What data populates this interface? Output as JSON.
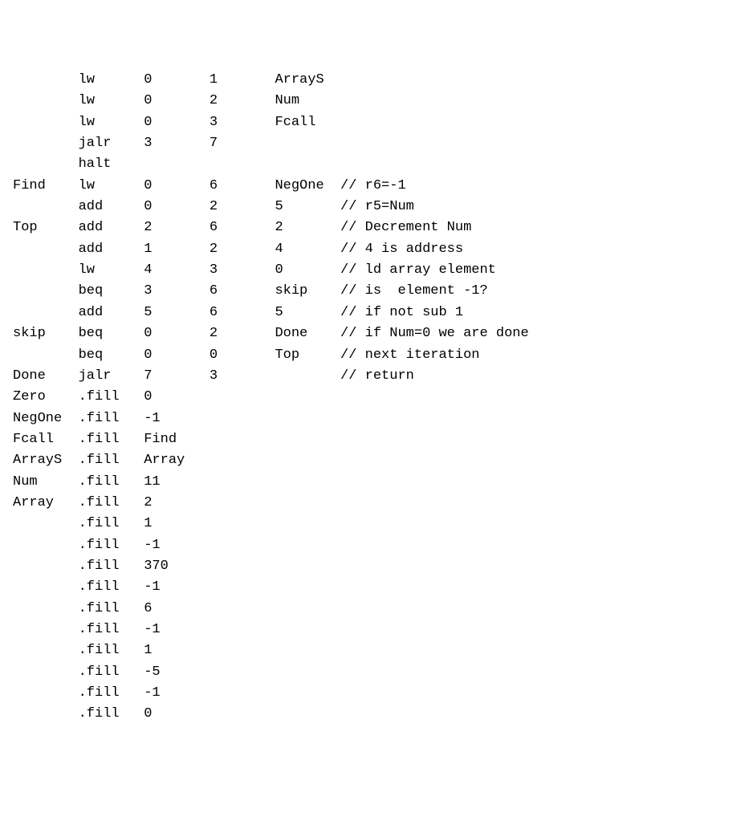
{
  "rows": [
    {
      "label": "",
      "op": "lw",
      "a": "0",
      "b": "1",
      "c": "ArrayS",
      "cm": ""
    },
    {
      "label": "",
      "op": "lw",
      "a": "0",
      "b": "2",
      "c": "Num",
      "cm": ""
    },
    {
      "label": "",
      "op": "lw",
      "a": "0",
      "b": "3",
      "c": "Fcall",
      "cm": ""
    },
    {
      "label": "",
      "op": "jalr",
      "a": "3",
      "b": "7",
      "c": "",
      "cm": ""
    },
    {
      "label": "",
      "op": "halt",
      "a": "",
      "b": "",
      "c": "",
      "cm": ""
    },
    {
      "label": "Find",
      "op": "lw",
      "a": "0",
      "b": "6",
      "c": "NegOne",
      "cm": "// r6=-1"
    },
    {
      "label": "",
      "op": "add",
      "a": "0",
      "b": "2",
      "c": "5",
      "cm": "// r5=Num"
    },
    {
      "label": "Top",
      "op": "add",
      "a": "2",
      "b": "6",
      "c": "2",
      "cm": "// Decrement Num"
    },
    {
      "label": "",
      "op": "add",
      "a": "1",
      "b": "2",
      "c": "4",
      "cm": "// 4 is address"
    },
    {
      "label": "",
      "op": "lw",
      "a": "4",
      "b": "3",
      "c": "0",
      "cm": "// ld array element"
    },
    {
      "label": "",
      "op": "beq",
      "a": "3",
      "b": "6",
      "c": "skip",
      "cm": "// is  element -1?"
    },
    {
      "label": "",
      "op": "add",
      "a": "5",
      "b": "6",
      "c": "5",
      "cm": "// if not sub 1"
    },
    {
      "label": "skip",
      "op": "beq",
      "a": "0",
      "b": "2",
      "c": "Done",
      "cm": "// if Num=0 we are done"
    },
    {
      "label": "",
      "op": "beq",
      "a": "0",
      "b": "0",
      "c": "Top",
      "cm": "// next iteration"
    },
    {
      "label": "Done",
      "op": "jalr",
      "a": "7",
      "b": "3",
      "c": "",
      "cm": "// return"
    },
    {
      "label": "Zero",
      "op": ".fill",
      "a": "0",
      "b": "",
      "c": "",
      "cm": ""
    },
    {
      "label": "NegOne",
      "op": ".fill",
      "a": "-1",
      "b": "",
      "c": "",
      "cm": ""
    },
    {
      "label": "Fcall",
      "op": ".fill",
      "a": "Find",
      "b": "",
      "c": "",
      "cm": ""
    },
    {
      "label": "ArrayS",
      "op": ".fill",
      "a": "Array",
      "b": "",
      "c": "",
      "cm": ""
    },
    {
      "label": "Num",
      "op": ".fill",
      "a": "11",
      "b": "",
      "c": "",
      "cm": ""
    },
    {
      "label": "Array",
      "op": ".fill",
      "a": "2",
      "b": "",
      "c": "",
      "cm": ""
    },
    {
      "label": "",
      "op": ".fill",
      "a": "1",
      "b": "",
      "c": "",
      "cm": ""
    },
    {
      "label": "",
      "op": ".fill",
      "a": "-1",
      "b": "",
      "c": "",
      "cm": ""
    },
    {
      "label": "",
      "op": ".fill",
      "a": "370",
      "b": "",
      "c": "",
      "cm": ""
    },
    {
      "label": "",
      "op": ".fill",
      "a": "-1",
      "b": "",
      "c": "",
      "cm": ""
    },
    {
      "label": "",
      "op": ".fill",
      "a": "6",
      "b": "",
      "c": "",
      "cm": ""
    },
    {
      "label": "",
      "op": ".fill",
      "a": "-1",
      "b": "",
      "c": "",
      "cm": ""
    },
    {
      "label": "",
      "op": ".fill",
      "a": "1",
      "b": "",
      "c": "",
      "cm": ""
    },
    {
      "label": "",
      "op": ".fill",
      "a": "-5",
      "b": "",
      "c": "",
      "cm": ""
    },
    {
      "label": "",
      "op": ".fill",
      "a": "-1",
      "b": "",
      "c": "",
      "cm": ""
    },
    {
      "label": "",
      "op": ".fill",
      "a": "0",
      "b": "",
      "c": "",
      "cm": ""
    }
  ]
}
